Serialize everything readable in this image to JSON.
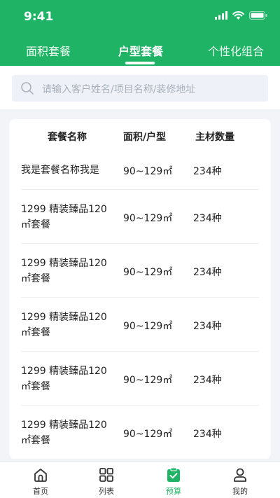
{
  "status_bar": {
    "time": "9:41"
  },
  "tabs": [
    {
      "label": "面积套餐",
      "active": false
    },
    {
      "label": "户型套餐",
      "active": true
    },
    {
      "label": "个性化组合",
      "active": false
    }
  ],
  "search": {
    "placeholder": "请输入客户姓名/项目名称/装修地址"
  },
  "table": {
    "headers": [
      "套餐名称",
      "面积/户型",
      "主材数量"
    ],
    "rows": [
      {
        "name": "我是套餐名称我是",
        "area": "90~129㎡",
        "count": "234种"
      },
      {
        "name": "1299 精装臻品120㎡套餐",
        "area": "90~129㎡",
        "count": "234种"
      },
      {
        "name": "1299 精装臻品120㎡套餐",
        "area": "90~129㎡",
        "count": "234种"
      },
      {
        "name": "1299 精装臻品120㎡套餐",
        "area": "90~129㎡",
        "count": "234种"
      },
      {
        "name": "1299 精装臻品120㎡套餐",
        "area": "90~129㎡",
        "count": "234种"
      },
      {
        "name": "1299 精装臻品120㎡套餐",
        "area": "90~129㎡",
        "count": "234种"
      }
    ]
  },
  "bottom_nav": [
    {
      "label": "首页",
      "icon": "home-icon",
      "active": false
    },
    {
      "label": "列表",
      "icon": "grid-icon",
      "active": false
    },
    {
      "label": "预算",
      "icon": "clipboard-check-icon",
      "active": true
    },
    {
      "label": "我的",
      "icon": "user-icon",
      "active": false
    }
  ],
  "colors": {
    "brand": "#1fb366",
    "background": "#f2f4f7"
  }
}
